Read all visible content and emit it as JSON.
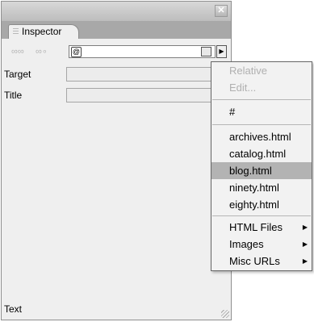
{
  "panel": {
    "close_glyph": "✕",
    "tab_label": "Inspector",
    "link_icons": [
      "∞∞",
      "∞∘"
    ],
    "url_value": "",
    "url_at_glyph": "@",
    "arrow_glyph": "▶",
    "fields": [
      {
        "label": "Target",
        "value": ""
      },
      {
        "label": "Title",
        "value": ""
      }
    ],
    "bottom_label": "Text"
  },
  "menu": {
    "items": [
      {
        "label": "Relative",
        "state": "disabled"
      },
      {
        "label": "Edit...",
        "state": "disabled"
      },
      {
        "label": "#",
        "state": "normal"
      },
      {
        "label": "archives.html",
        "state": "normal"
      },
      {
        "label": "catalog.html",
        "state": "normal"
      },
      {
        "label": "blog.html",
        "state": "selected"
      },
      {
        "label": "ninety.html",
        "state": "normal"
      },
      {
        "label": "eighty.html",
        "state": "normal"
      },
      {
        "label": "HTML Files",
        "state": "submenu"
      },
      {
        "label": "Images",
        "state": "submenu"
      },
      {
        "label": "Misc URLs",
        "state": "submenu"
      }
    ],
    "submenu_glyph": "▶"
  }
}
